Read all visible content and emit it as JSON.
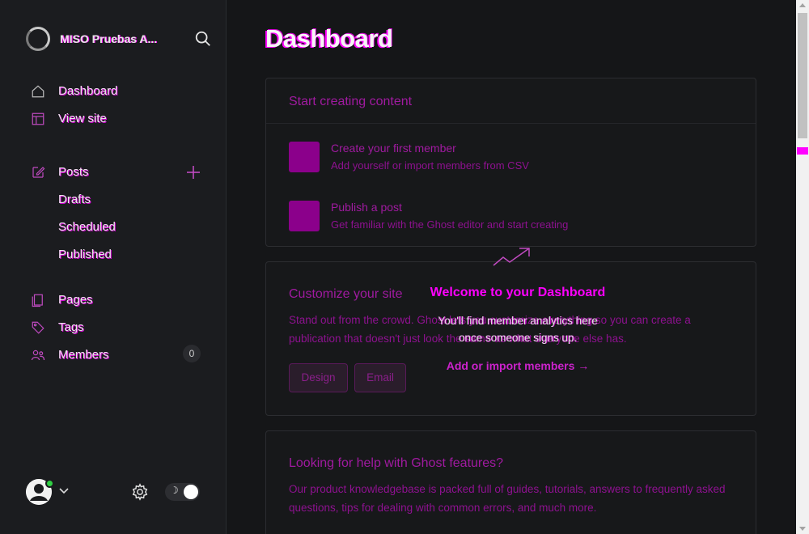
{
  "sidebar": {
    "brand": "MISO Pruebas A...",
    "nav": {
      "dashboard": "Dashboard",
      "view_site": "View site",
      "posts": "Posts",
      "drafts": "Drafts",
      "scheduled": "Scheduled",
      "published": "Published",
      "pages": "Pages",
      "tags": "Tags",
      "members": "Members"
    },
    "members_count": "0",
    "toggle_icon": "☽"
  },
  "main": {
    "title": "Dashboard",
    "start_card": {
      "title": "Start creating content",
      "items": [
        {
          "title": "Create your first member",
          "subtitle": "Add yourself or import members from CSV"
        },
        {
          "title": "Publish a post",
          "subtitle": "Get familiar with the Ghost editor and start creating"
        }
      ]
    },
    "customize_card": {
      "title": "Customize your site",
      "text": "Stand out from the crowd. Ghost lets you customize everything so you can create a publication that doesn't just look the same as what everyone else has.",
      "design_label": "Design",
      "email_label": "Email"
    },
    "welcome": {
      "title": "Welcome to your Dashboard",
      "text": "You'll find member analytics here once someone signs up.",
      "link": "Add or import members →"
    },
    "help_card": {
      "title": "Looking for help with Ghost features?",
      "text": "Our product knowledgebase is packed full of guides, tutorials, answers to frequently asked questions, tips for dealing with common errors, and much more."
    }
  },
  "colors": {
    "accent": "#ff00ff",
    "muted_accent": "#8e1190",
    "status_online": "#30cf43"
  }
}
